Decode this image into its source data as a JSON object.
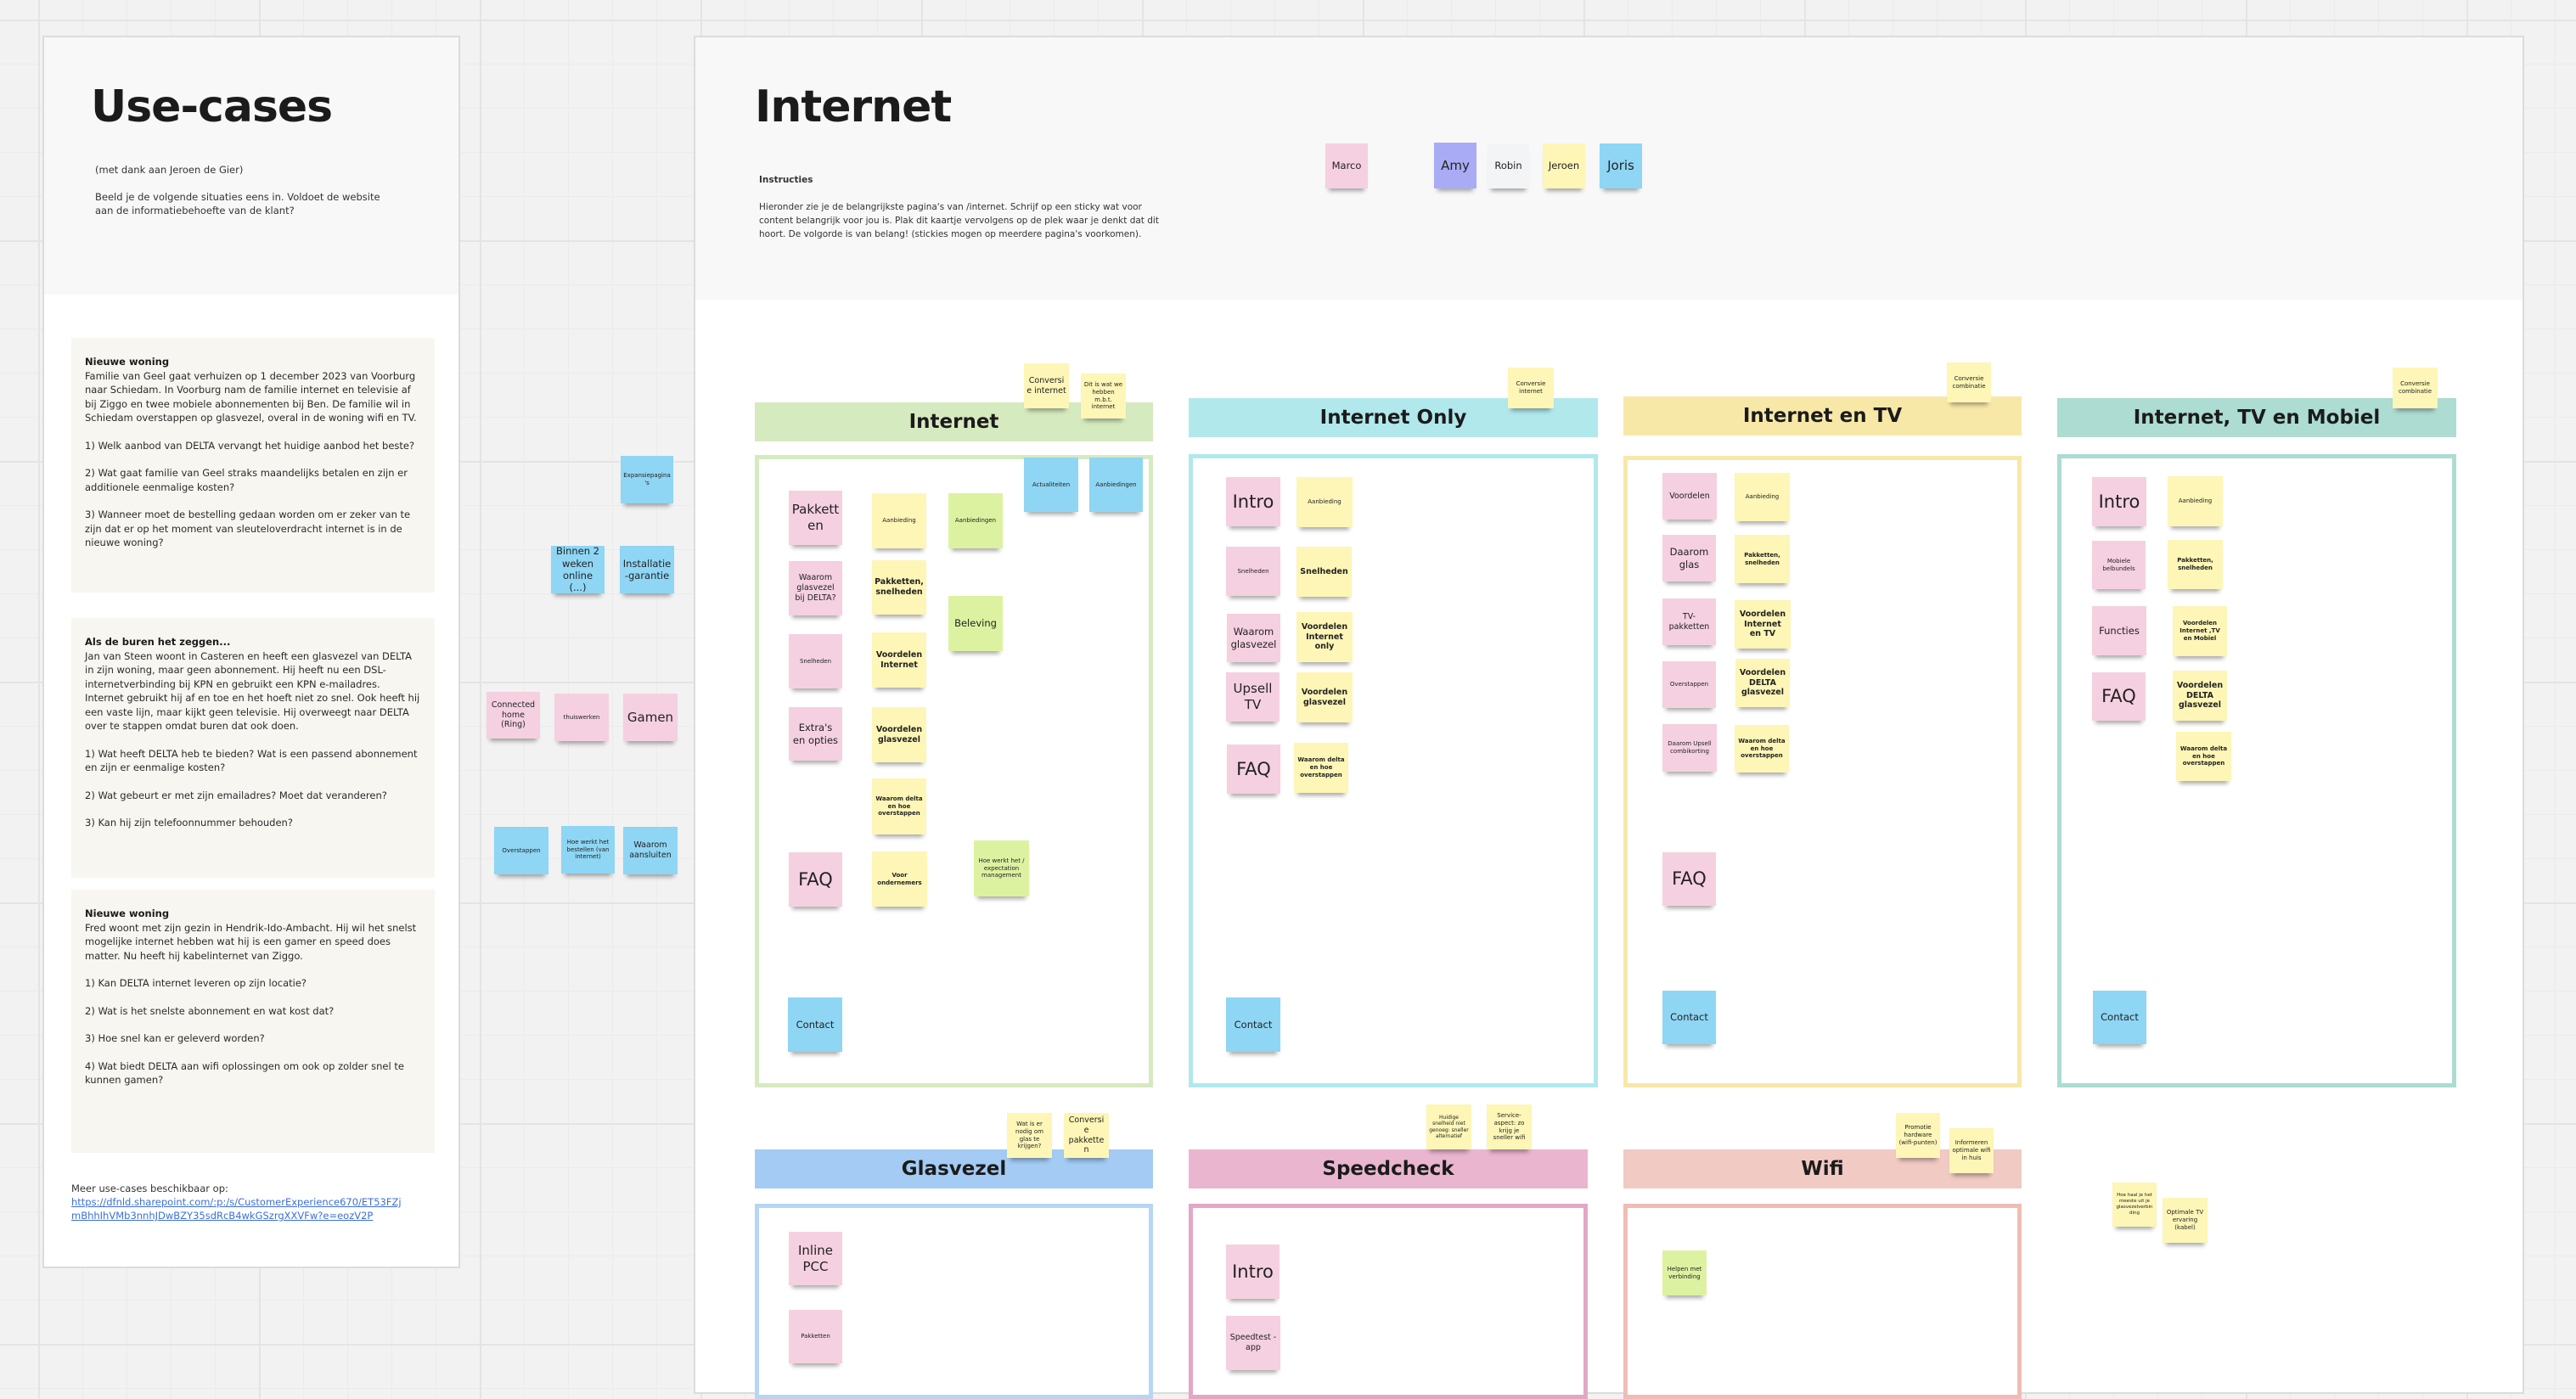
{
  "colors": {
    "canvas_background": "#f2f2f2",
    "sticky_pink": "#f5d0e0",
    "sticky_yellow": "#fdf6b6",
    "sticky_blue": "#8ed6f4",
    "sticky_green": "#ddf2a0",
    "sticky_violet": "#a9acf4",
    "link": "#3b6fd6"
  },
  "use_cases_frame": {
    "title": "Use-cases",
    "credit": "(met dank aan Jeroen de Gier)",
    "intro": "Beeld je de volgende situaties eens in. Voldoet de website aan de informatiebehoefte van de klant?",
    "cases": [
      {
        "title": "Nieuwe woning",
        "body": "Familie van Geel gaat verhuizen op 1 december 2023 van Voorburg naar Schiedam. In Voorburg nam de familie internet en televisie af bij Ziggo en twee mobiele abonnementen bij Ben. De familie wil in Schiedam overstappen op glasvezel, overal in de woning wifi en TV.",
        "questions": [
          "1) Welk aanbod van DELTA vervangt het huidige aanbod het beste?",
          "2) Wat gaat familie van Geel straks maandelijks betalen en zijn er additionele eenmalige kosten?",
          "3) Wanneer moet de bestelling gedaan worden om er zeker van te zijn dat er op het moment van sleuteloverdracht internet is in de nieuwe woning?"
        ]
      },
      {
        "title": "Als de buren het zeggen...",
        "body": "Jan van Steen woont in  Casteren en heeft een glasvezel van DELTA in zijn woning, maar geen abonnement. Hij heeft nu een DSL-internetverbinding bij KPN en gebruikt een KPN e-mailadres. Internet gebruikt hij af en toe en het hoeft niet zo snel. Ook heeft hij een vaste lijn, maar kijkt geen televisie. Hij overweegt naar DELTA over te stappen omdat buren dat ook doen.",
        "questions": [
          "1) Wat heeft DELTA heb te bieden? Wat is een passend abonnement en zijn er eenmalige kosten?",
          "2) Wat gebeurt er met zijn emailadres? Moet dat veranderen?",
          "3) Kan hij zijn telefoonnummer behouden?"
        ]
      },
      {
        "title": "Nieuwe woning",
        "body": "Fred woont met zijn gezin in Hendrik-Ido-Ambacht. Hij wil het snelst mogelijke internet hebben wat hij is een gamer en speed does matter. Nu heeft hij kabelinternet van Ziggo.",
        "questions": [
          "1) Kan DELTA internet leveren op zijn locatie?",
          "2) Wat is het snelste abonnement en wat kost dat?",
          "3) Hoe snel kan er geleverd worden?",
          "4) Wat biedt DELTA aan wifi oplossingen om ook op zolder snel te kunnen gamen?"
        ]
      }
    ],
    "more_label": "Meer use-cases beschikbaar op:",
    "more_link": "https://dfnld.sharepoint.com/:p:/s/CustomerExperience670/ET53FZjmBhhIhVMb3nnhJDwBZY35sdRcB4wkGSzrgXXVFw?e=eozV2P"
  },
  "loose_stickies": [
    {
      "text": "Expansiepagina's",
      "color": "blue"
    },
    {
      "text": "Binnen 2 weken online (...)",
      "color": "blue"
    },
    {
      "text": "Installatie-garantie",
      "color": "blue"
    },
    {
      "text": "Connected home (Ring)",
      "color": "pink"
    },
    {
      "text": "thuiswerken",
      "color": "pink"
    },
    {
      "text": "Gamen",
      "color": "pink"
    },
    {
      "text": "Overstappen",
      "color": "blue"
    },
    {
      "text": "Hoe werkt het bestellen (van internet)",
      "color": "blue"
    },
    {
      "text": "Waarom aansluiten",
      "color": "blue"
    }
  ],
  "internet_frame": {
    "title": "Internet",
    "instructions_label": "Instructies",
    "instructions_text": "Hieronder zie je de belangrijkste pagina's van /internet. Schrijf op een sticky wat voor content belangrijk voor jou is. Plak dit kaartje vervolgens op de plek waar je denkt dat dit hoort. De volgorde is van belang! (stickies mogen op meerdere pagina's voorkomen).",
    "participants": [
      {
        "name": "Marco",
        "color": "pink"
      },
      {
        "name": "Amy",
        "color": "violet"
      },
      {
        "name": "Robin",
        "color": "white"
      },
      {
        "name": "Jeroen",
        "color": "yellow"
      },
      {
        "name": "Joris",
        "color": "blue"
      }
    ]
  },
  "columns": [
    {
      "title": "Internet",
      "header_color": "#d6eabf",
      "frame_color": "#d6eabf",
      "notes_above": [
        "Conversie internet",
        "Dit is wat we hebben m.b.t. internet"
      ],
      "stickies": [
        {
          "text": "Actualiteiten",
          "color": "blue"
        },
        {
          "text": "Aanbiedingen",
          "color": "blue"
        },
        {
          "text": "Pakketten",
          "color": "pink"
        },
        {
          "text": "Aanbieding",
          "color": "yellow"
        },
        {
          "text": "Aanbiedingen",
          "color": "green"
        },
        {
          "text": "Waarom glasvezel bij DELTA?",
          "color": "pink"
        },
        {
          "text": "Pakketten, snelheden",
          "color": "yellow"
        },
        {
          "text": "Beleving",
          "color": "green"
        },
        {
          "text": "Snelheden",
          "color": "pink"
        },
        {
          "text": "Voordelen Internet",
          "color": "yellow"
        },
        {
          "text": "Extra's en opties",
          "color": "pink"
        },
        {
          "text": "Voordelen glasvezel",
          "color": "yellow"
        },
        {
          "text": "Waarom delta en hoe overstappen",
          "color": "yellow"
        },
        {
          "text": "FAQ",
          "color": "pink"
        },
        {
          "text": "Voor ondernemers",
          "color": "yellow"
        },
        {
          "text": "Hoe werkt het / expectation management",
          "color": "green"
        },
        {
          "text": "Contact",
          "color": "blue"
        }
      ]
    },
    {
      "title": "Internet Only",
      "header_color": "#b0e8ec",
      "frame_color": "#b0e8ec",
      "notes_above": [
        "Conversie internet"
      ],
      "stickies": [
        {
          "text": "Intro",
          "color": "pink"
        },
        {
          "text": "Aanbieding",
          "color": "yellow"
        },
        {
          "text": "Snelheden",
          "color": "pink"
        },
        {
          "text": "Snelheden",
          "color": "yellow"
        },
        {
          "text": "Waarom glasvezel",
          "color": "pink"
        },
        {
          "text": "Voordelen Internet only",
          "color": "yellow"
        },
        {
          "text": "Upsell TV",
          "color": "pink"
        },
        {
          "text": "Voordelen glasvezel",
          "color": "yellow"
        },
        {
          "text": "FAQ",
          "color": "pink"
        },
        {
          "text": "Waarom delta en hoe overstappen",
          "color": "yellow"
        },
        {
          "text": "Contact",
          "color": "blue"
        }
      ]
    },
    {
      "title": "Internet en TV",
      "header_color": "#f8e8a8",
      "frame_color": "#f8e8a8",
      "notes_above": [
        "Conversie combinatie"
      ],
      "stickies": [
        {
          "text": "Voordelen",
          "color": "pink"
        },
        {
          "text": "Aanbieding",
          "color": "yellow"
        },
        {
          "text": "Daarom glas",
          "color": "pink"
        },
        {
          "text": "Pakketten, snelheden",
          "color": "yellow"
        },
        {
          "text": "TV-pakketten",
          "color": "pink"
        },
        {
          "text": "Voordelen Internet en TV",
          "color": "yellow"
        },
        {
          "text": "Overstappen",
          "color": "pink"
        },
        {
          "text": "Voordelen DELTA glasvezel",
          "color": "yellow"
        },
        {
          "text": "Daarom Upsell combikorting",
          "color": "pink"
        },
        {
          "text": "Waarom delta en hoe overstappen",
          "color": "yellow"
        },
        {
          "text": "FAQ",
          "color": "pink"
        },
        {
          "text": "Contact",
          "color": "blue"
        }
      ]
    },
    {
      "title": "Internet, TV en Mobiel",
      "header_color": "#acdcd2",
      "frame_color": "#acdcd2",
      "notes_above": [
        "Conversie combinatie"
      ],
      "stickies": [
        {
          "text": "Intro",
          "color": "pink"
        },
        {
          "text": "Aanbieding",
          "color": "yellow"
        },
        {
          "text": "Mobiele belbundels",
          "color": "pink"
        },
        {
          "text": "Pakketten, snelheden",
          "color": "yellow"
        },
        {
          "text": "Functies",
          "color": "pink"
        },
        {
          "text": "Voordelen Internet ,TV en Mobiel",
          "color": "yellow"
        },
        {
          "text": "FAQ",
          "color": "pink"
        },
        {
          "text": "Voordelen DELTA glasvezel",
          "color": "yellow"
        },
        {
          "text": "Waarom delta en hoe overstappen",
          "color": "yellow"
        },
        {
          "text": "Contact",
          "color": "blue"
        }
      ]
    },
    {
      "title": "Glasvezel",
      "header_color": "#a3cbf3",
      "frame_color": "#b5d6f5",
      "notes_above": [
        "Wat is er nodig om glas te krijgen?",
        "Conversie pakketten"
      ],
      "stickies": [
        {
          "text": "Inline PCC",
          "color": "pink"
        },
        {
          "text": "Pakketten",
          "color": "pink"
        }
      ]
    },
    {
      "title": "Speedcheck",
      "header_color": "#e9b5cf",
      "frame_color": "#e3a7c5",
      "notes_above": [
        "Huidige snelheid niet genoeg: sneller alternatief",
        "Service-aspect: zo krijg je sneller wifi"
      ],
      "stickies": [
        {
          "text": "Intro",
          "color": "pink"
        },
        {
          "text": "Speedtest -app",
          "color": "pink"
        }
      ]
    },
    {
      "title": "Wifi",
      "header_color": "#f1cac3",
      "frame_color": "#efbdb5",
      "notes_above": [
        "Promotie hardware (wifi-punten)",
        "Informeren optimale wifi in huis"
      ],
      "stickies": [
        {
          "text": "Helpen met verbinding",
          "color": "green"
        }
      ]
    }
  ],
  "extra_notes": [
    {
      "text": "Hoe haal je het meeste uit je glasvezelverbinding",
      "color": "yellow"
    },
    {
      "text": "Optimale TV ervaring (kabel)",
      "color": "yellow"
    }
  ]
}
